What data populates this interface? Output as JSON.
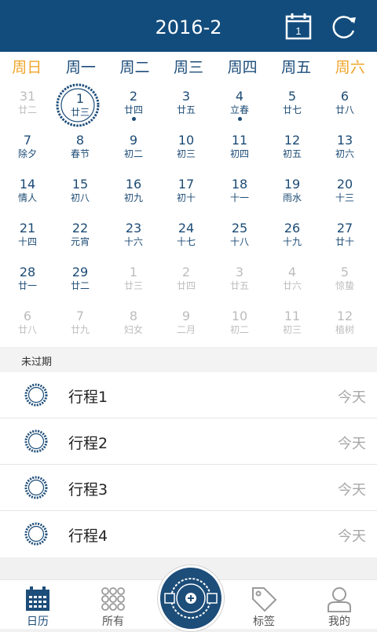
{
  "header": {
    "title": "2016-2",
    "calendar_icon_day": "1"
  },
  "weekdays": [
    "周日",
    "周一",
    "周二",
    "周三",
    "周四",
    "周五",
    "周六"
  ],
  "days": [
    {
      "num": "31",
      "lunar": "廿二",
      "other": true
    },
    {
      "num": "1",
      "lunar": "廿三",
      "selected": true
    },
    {
      "num": "2",
      "lunar": "廿四",
      "dot": true
    },
    {
      "num": "3",
      "lunar": "廿五"
    },
    {
      "num": "4",
      "lunar": "立春",
      "dot": true
    },
    {
      "num": "5",
      "lunar": "廿七"
    },
    {
      "num": "6",
      "lunar": "廿八"
    },
    {
      "num": "7",
      "lunar": "除夕"
    },
    {
      "num": "8",
      "lunar": "春节"
    },
    {
      "num": "9",
      "lunar": "初二"
    },
    {
      "num": "10",
      "lunar": "初三"
    },
    {
      "num": "11",
      "lunar": "初四"
    },
    {
      "num": "12",
      "lunar": "初五"
    },
    {
      "num": "13",
      "lunar": "初六"
    },
    {
      "num": "14",
      "lunar": "情人"
    },
    {
      "num": "15",
      "lunar": "初八"
    },
    {
      "num": "16",
      "lunar": "初九"
    },
    {
      "num": "17",
      "lunar": "初十"
    },
    {
      "num": "18",
      "lunar": "十一"
    },
    {
      "num": "19",
      "lunar": "雨水"
    },
    {
      "num": "20",
      "lunar": "十三"
    },
    {
      "num": "21",
      "lunar": "十四"
    },
    {
      "num": "22",
      "lunar": "元宵"
    },
    {
      "num": "23",
      "lunar": "十六"
    },
    {
      "num": "24",
      "lunar": "十七"
    },
    {
      "num": "25",
      "lunar": "十八"
    },
    {
      "num": "26",
      "lunar": "十九"
    },
    {
      "num": "27",
      "lunar": "廿十"
    },
    {
      "num": "28",
      "lunar": "廿一"
    },
    {
      "num": "29",
      "lunar": "廿二"
    },
    {
      "num": "1",
      "lunar": "廿三",
      "other": true
    },
    {
      "num": "2",
      "lunar": "廿四",
      "other": true
    },
    {
      "num": "3",
      "lunar": "廿五",
      "other": true
    },
    {
      "num": "4",
      "lunar": "廿六",
      "other": true
    },
    {
      "num": "5",
      "lunar": "惊蛰",
      "other": true
    },
    {
      "num": "6",
      "lunar": "廿八",
      "other": true
    },
    {
      "num": "7",
      "lunar": "廿九",
      "other": true
    },
    {
      "num": "8",
      "lunar": "妇女",
      "other": true
    },
    {
      "num": "9",
      "lunar": "二月",
      "other": true
    },
    {
      "num": "10",
      "lunar": "初二",
      "other": true
    },
    {
      "num": "11",
      "lunar": "初三",
      "other": true
    },
    {
      "num": "12",
      "lunar": "植树",
      "other": true
    }
  ],
  "section": {
    "label": "未过期"
  },
  "schedule": [
    {
      "name": "行程1",
      "when": "今天"
    },
    {
      "name": "行程2",
      "when": "今天"
    },
    {
      "name": "行程3",
      "when": "今天"
    },
    {
      "name": "行程4",
      "when": "今天"
    }
  ],
  "tabs": [
    {
      "label": "日历",
      "active": true
    },
    {
      "label": "所有"
    },
    {
      "label": "标签"
    },
    {
      "label": "我的"
    }
  ],
  "colors": {
    "primary": "#124c7d",
    "weekend": "#f0a52a",
    "muted": "#bdbdbd"
  }
}
